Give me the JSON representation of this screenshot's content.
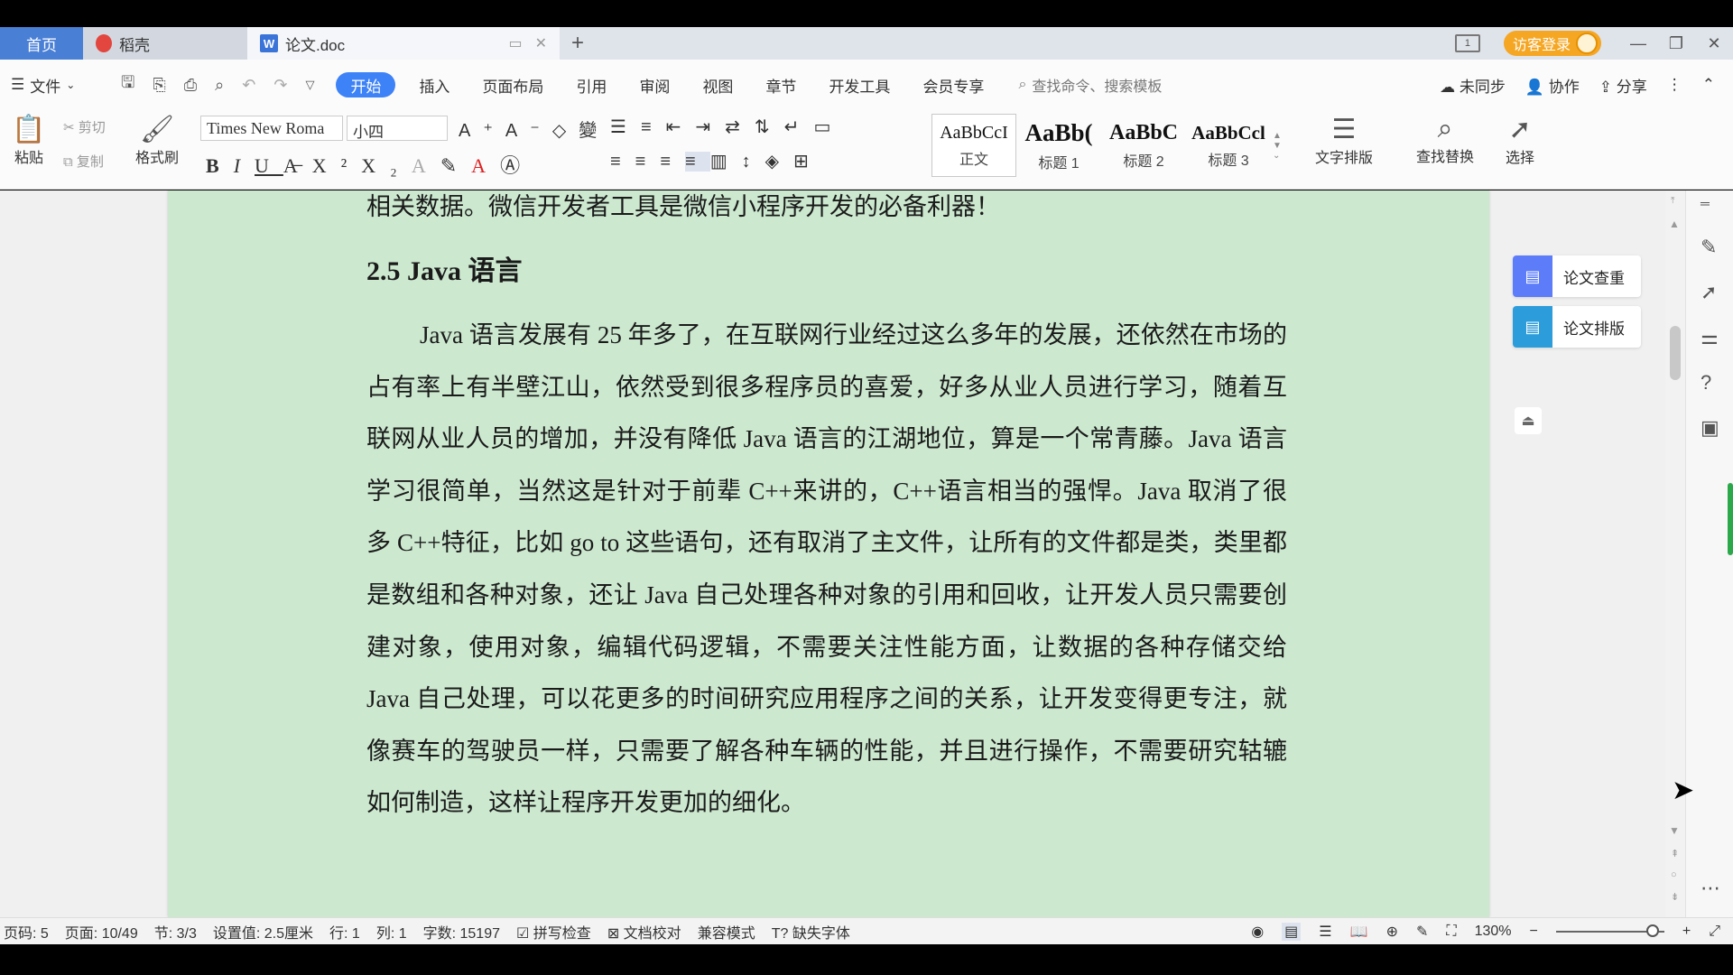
{
  "tabs": {
    "home": "首页",
    "docer": "稻壳",
    "doc": "论文.doc",
    "doc_icon": "W",
    "add": "+",
    "visitor": "访客登录",
    "window_badge": "1"
  },
  "menubar": {
    "file": "文件",
    "items": [
      "开始",
      "插入",
      "页面布局",
      "引用",
      "审阅",
      "视图",
      "章节",
      "开发工具",
      "会员专享"
    ],
    "search_placeholder": "查找命令、搜索模板",
    "sync": "未同步",
    "collab": "协作",
    "share": "分享"
  },
  "ribbon": {
    "paste": "粘贴",
    "cut": "剪切",
    "copy": "复制",
    "format_painter": "格式刷",
    "font_name": "Times New Roma",
    "font_size": "小四",
    "styles": [
      {
        "preview": "AaBbCcI",
        "name": "正文"
      },
      {
        "preview": "AaBb(",
        "name": "标题 1"
      },
      {
        "preview": "AaBbC",
        "name": "标题 2"
      },
      {
        "preview": "AaBbCcl",
        "name": "标题 3"
      }
    ],
    "text_layout": "文字排版",
    "find_replace": "查找替换",
    "select": "选择"
  },
  "document": {
    "line0": "相关数据。微信开发者工具是微信小程序开发的必备利器！",
    "heading": "2.5 Java 语言",
    "paragraph": "Java 语言发展有 25 年多了，在互联网行业经过这么多年的发展，还依然在市场的占有率上有半壁江山，依然受到很多程序员的喜爱，好多从业人员进行学习，随着互联网从业人员的增加，并没有降低 Java 语言的江湖地位，算是一个常青藤。Java 语言学习很简单，当然这是针对于前辈 C++来讲的，C++语言相当的强悍。Java 取消了很多 C++特征，比如 go to 这些语句，还有取消了主文件，让所有的文件都是类，类里都是数组和各种对象，还让 Java 自己处理各种对象的引用和回收，让开发人员只需要创建对象，使用对象，编辑代码逻辑，不需要关注性能方面，让数据的各种存储交给 Java 自己处理，可以花更多的时间研究应用程序之间的关系，让开发变得更专注，就像赛车的驾驶员一样，只需要了解各种车辆的性能，并且进行操作，不需要研究轱辘如何制造，这样让程序开发更加的细化。"
  },
  "assist": {
    "check": "论文查重",
    "layout": "论文排版"
  },
  "status": {
    "page_code": "页码: 5",
    "page": "页面: 10/49",
    "section": "节: 3/3",
    "setting": "设置值: 2.5厘米",
    "row": "行: 1",
    "col": "列: 1",
    "words": "字数: 15197",
    "spell": "拼写检查",
    "proof": "文档校对",
    "compat": "兼容模式",
    "missing_font": "缺失字体",
    "zoom": "130%"
  }
}
